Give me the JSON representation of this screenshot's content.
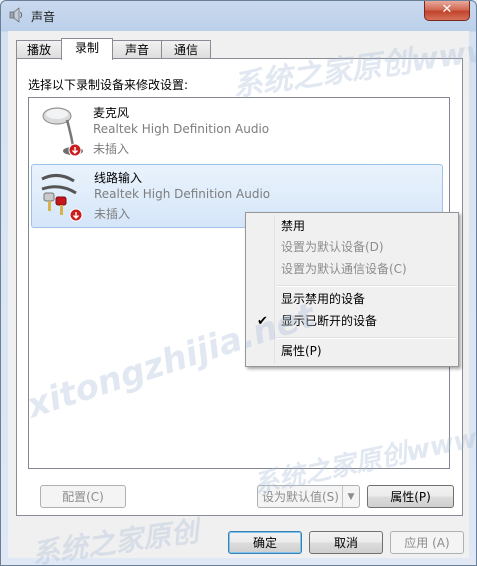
{
  "window": {
    "title": "声音",
    "close_label": "✕"
  },
  "tabs": [
    {
      "label": "播放",
      "active": false
    },
    {
      "label": "录制",
      "active": true
    },
    {
      "label": "声音",
      "active": false
    },
    {
      "label": "通信",
      "active": false
    }
  ],
  "panel": {
    "instruction": "选择以下录制设备来修改设置:"
  },
  "devices": [
    {
      "name": "麦克风",
      "driver": "Realtek High Definition Audio",
      "status": "未插入",
      "icon": "microphone-icon"
    },
    {
      "name": "线路输入",
      "driver": "Realtek High Definition Audio",
      "status": "未插入",
      "icon": "line-in-icon"
    }
  ],
  "context_menu": {
    "items": [
      {
        "label": "禁用",
        "enabled": true,
        "checked": false
      },
      {
        "label": "设置为默认设备(D)",
        "enabled": false,
        "checked": false
      },
      {
        "label": "设置为默认通信设备(C)",
        "enabled": false,
        "checked": false
      },
      {
        "label": "显示禁用的设备",
        "enabled": true,
        "checked": false
      },
      {
        "label": "显示已断开的设备",
        "enabled": true,
        "checked": true
      },
      {
        "label": "属性(P)",
        "enabled": true,
        "checked": false
      }
    ]
  },
  "buttons": {
    "configure": "配置(C)",
    "set_default": "设为默认值(S)",
    "properties": "属性(P)",
    "ok": "确定",
    "cancel": "取消",
    "apply": "应用 (A)"
  },
  "watermarks": [
    "系统之家原创www",
    "xitongzhijia.net",
    "系统之家原创www",
    "系统之家原创"
  ],
  "colors": {
    "selection": "#d5e6f9",
    "disabled_text": "#8d8d8d",
    "status_icon": "#c81e1e"
  }
}
